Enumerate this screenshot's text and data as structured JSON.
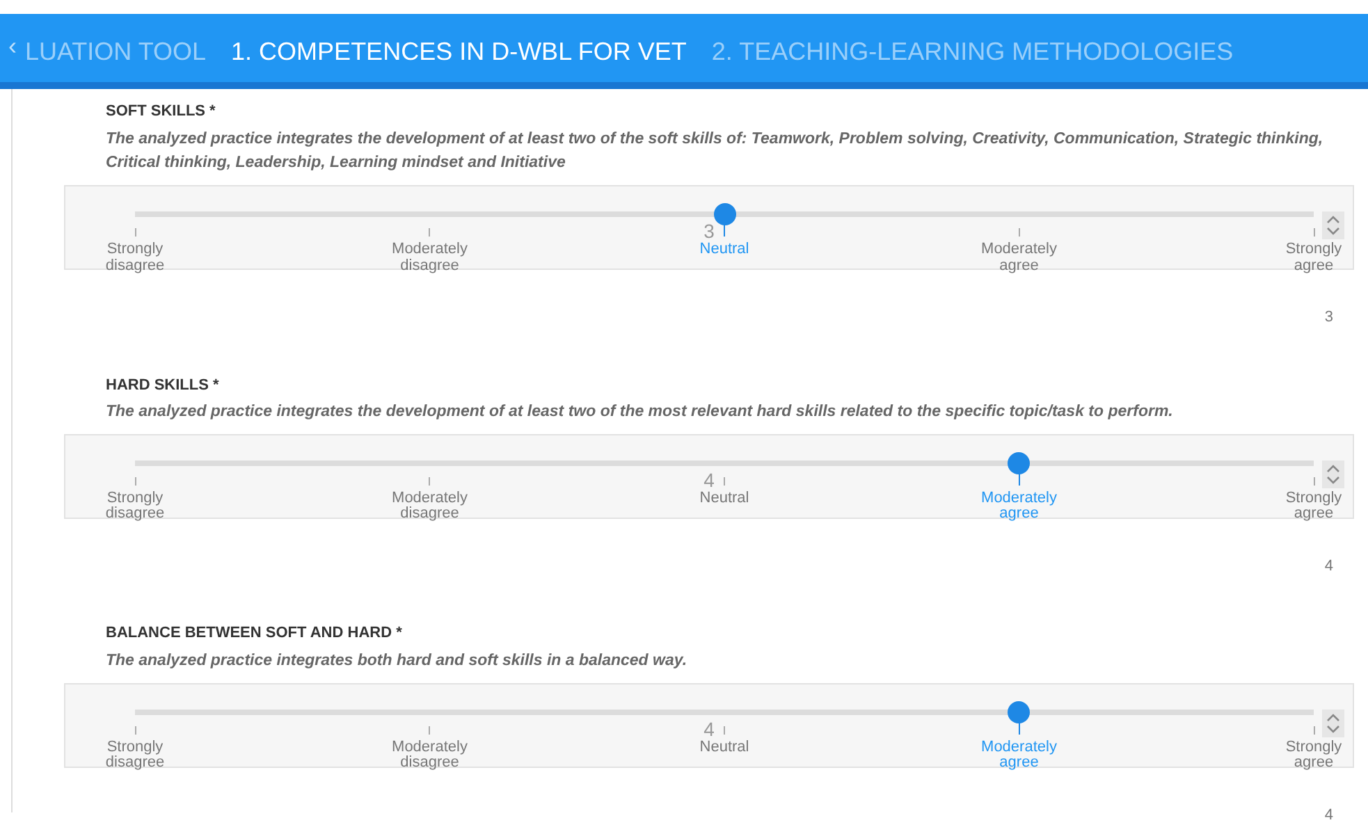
{
  "tab_bar": {
    "scroll_left": "‹",
    "tabs": [
      {
        "label": "LUATION TOOL",
        "selected": false
      },
      {
        "label": "1. COMPETENCES IN D-WBL FOR VET",
        "selected": true
      },
      {
        "label": "2. TEACHING-LEARNING METHODOLOGIES",
        "selected": false
      }
    ]
  },
  "questions": [
    {
      "title": "SOFT SKILLS",
      "required_mark": "*",
      "description": "The analyzed practice integrates the development of at least two of the soft skills of: Teamwork, Problem solving, Creativity, Communication, Strategic thinking, Critical thinking, Leadership, Learning mindset and Initiative",
      "value": "3",
      "level": 0.5,
      "reading": "3",
      "options": [
        {
          "label": "Strongly disagree",
          "selected": false
        },
        {
          "label": "Moderately disagree",
          "selected": false
        },
        {
          "label": "Neutral",
          "selected": true
        },
        {
          "label": "Moderately agree",
          "selected": false
        },
        {
          "label": "Strongly agree",
          "selected": false
        }
      ]
    },
    {
      "title": "HARD SKILLS",
      "required_mark": "*",
      "description": "The analyzed practice integrates the development of at least two of the most relevant hard skills related to the specific topic/task to perform.",
      "value": "4",
      "level": 0.75,
      "reading": "4",
      "options": [
        {
          "label": "Strongly disagree",
          "selected": false
        },
        {
          "label": "Moderately disagree",
          "selected": false
        },
        {
          "label": "Neutral",
          "selected": false
        },
        {
          "label": "Moderately agree",
          "selected": true
        },
        {
          "label": "Strongly agree",
          "selected": false
        }
      ]
    },
    {
      "title": "BALANCE BETWEEN SOFT AND HARD",
      "required_mark": "*",
      "description": "The analyzed practice integrates both hard and soft skills in a balanced way.",
      "value": "4",
      "level": 0.75,
      "reading": "4",
      "options": [
        {
          "label": "Strongly disagree",
          "selected": false
        },
        {
          "label": "Moderately disagree",
          "selected": false
        },
        {
          "label": "Neutral",
          "selected": false
        },
        {
          "label": "Moderately agree",
          "selected": true
        },
        {
          "label": "Strongly agree",
          "selected": false
        }
      ]
    }
  ]
}
